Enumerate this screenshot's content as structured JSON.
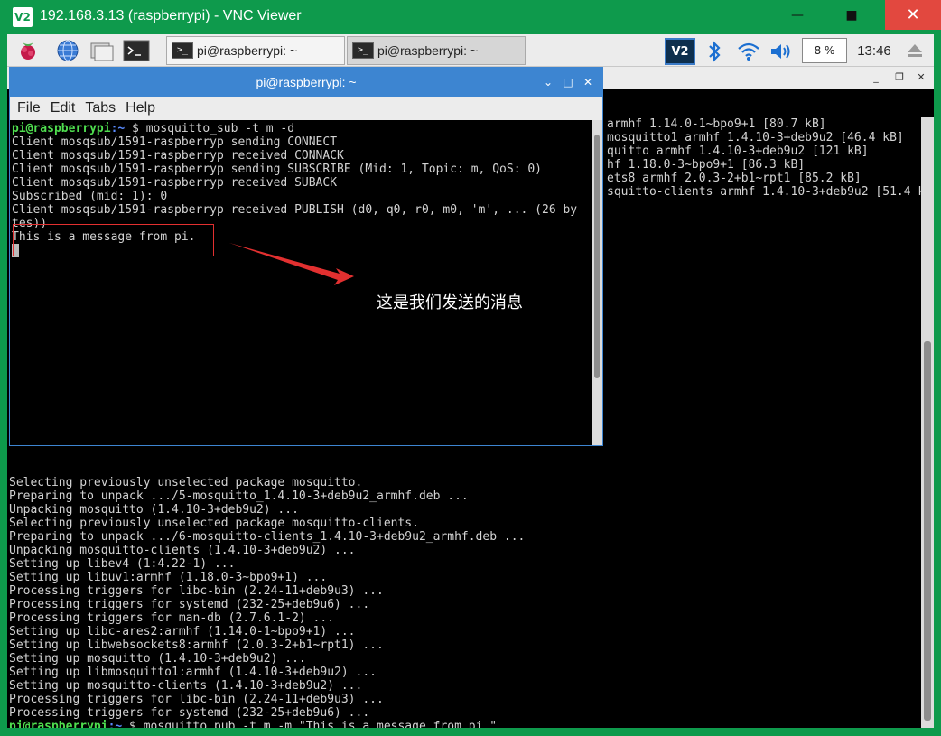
{
  "window": {
    "logo": "V2",
    "title": "192.168.3.13 (raspberrypi) - VNC Viewer",
    "minimize": "—",
    "maximize": "■",
    "close": "✕"
  },
  "panel": {
    "tasks": [
      {
        "label": "pi@raspberrypi: ~"
      },
      {
        "label": "pi@raspberrypi: ~"
      }
    ],
    "tray_vnc": "V2",
    "cpu": "8 %",
    "clock": "13:46"
  },
  "fg_terminal": {
    "title": "pi@raspberrypi: ~",
    "menu": [
      "File",
      "Edit",
      "Tabs",
      "Help"
    ],
    "prompt_user": "pi@raspberrypi",
    "prompt_path": ":~",
    "prompt_sym": " $ ",
    "command": "mosquitto_sub -t m -d",
    "lines": [
      "Client mosqsub/1591-raspberryp sending CONNECT",
      "Client mosqsub/1591-raspberryp received CONNACK",
      "Client mosqsub/1591-raspberryp sending SUBSCRIBE (Mid: 1, Topic: m, QoS: 0)",
      "Client mosqsub/1591-raspberryp received SUBACK",
      "Subscribed (mid: 1): 0",
      "Client mosqsub/1591-raspberryp received PUBLISH (d0, q0, r0, m0, 'm', ... (26 by",
      "tes))",
      "This is a message from pi."
    ]
  },
  "bg_terminal": {
    "right_lines": [
      "armhf 1.14.0-1~bpo9+1 [80.7 kB]",
      "mosquitto1 armhf 1.4.10-3+deb9u2 [46.4 kB]",
      "quitto armhf 1.4.10-3+deb9u2 [121 kB]",
      "hf 1.18.0-3~bpo9+1 [86.3 kB]",
      "ets8 armhf 2.0.3-2+b1~rpt1 [85.2 kB]",
      "squitto-clients armhf 1.4.10-3+deb9u2 [51.4 k"
    ],
    "lines": [
      "Selecting previously unselected package mosquitto.",
      "Preparing to unpack .../5-mosquitto_1.4.10-3+deb9u2_armhf.deb ...",
      "Unpacking mosquitto (1.4.10-3+deb9u2) ...",
      "Selecting previously unselected package mosquitto-clients.",
      "Preparing to unpack .../6-mosquitto-clients_1.4.10-3+deb9u2_armhf.deb ...",
      "Unpacking mosquitto-clients (1.4.10-3+deb9u2) ...",
      "Setting up libev4 (1:4.22-1) ...",
      "Setting up libuv1:armhf (1.18.0-3~bpo9+1) ...",
      "Processing triggers for libc-bin (2.24-11+deb9u3) ...",
      "Processing triggers for systemd (232-25+deb9u6) ...",
      "Processing triggers for man-db (2.7.6.1-2) ...",
      "Setting up libc-ares2:armhf (1.14.0-1~bpo9+1) ...",
      "Setting up libwebsockets8:armhf (2.0.3-2+b1~rpt1) ...",
      "Setting up mosquitto (1.4.10-3+deb9u2) ...",
      "Setting up libmosquitto1:armhf (1.4.10-3+deb9u2) ...",
      "Setting up mosquitto-clients (1.4.10-3+deb9u2) ...",
      "Processing triggers for libc-bin (2.24-11+deb9u3) ...",
      "Processing triggers for systemd (232-25+deb9u6) ..."
    ],
    "prompt_user": "pi@raspberrypi",
    "prompt_path": ":~",
    "prompt_sym": " $ ",
    "pub_command": "mosquitto_pub -t m -m \"This is a message from pi.\""
  },
  "annotation": {
    "text": "这是我们发送的消息",
    "color": "#e23030"
  }
}
